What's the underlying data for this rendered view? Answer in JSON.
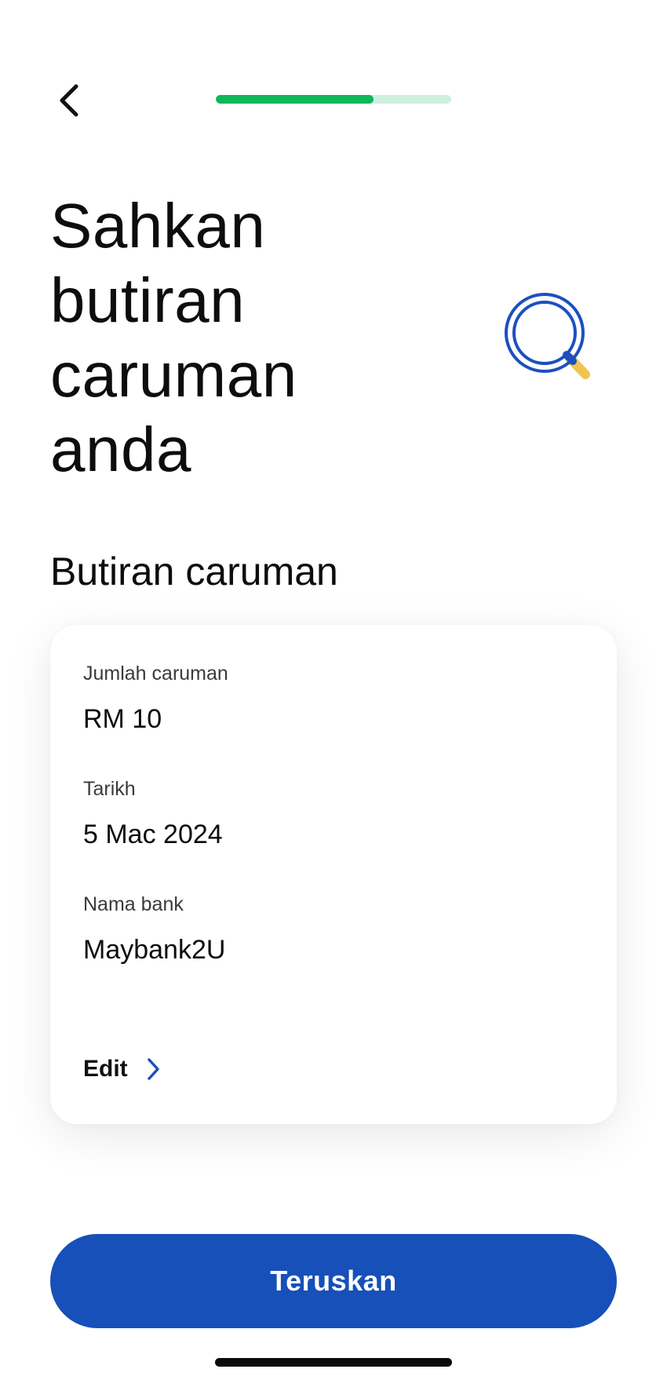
{
  "header": {
    "back_icon": "chevron-left-icon",
    "progress_fraction": 0.67
  },
  "title": {
    "line1": "Sahkan",
    "line2": "butiran",
    "line3": "caruman",
    "line4": "anda",
    "illustration_icon": "magnifying-glass-icon"
  },
  "section": {
    "heading": "Butiran caruman"
  },
  "details": {
    "amount_label": "Jumlah caruman",
    "amount_value": "RM 10",
    "date_label": "Tarikh",
    "date_value": "5 Mac 2024",
    "bank_label": "Nama bank",
    "bank_value": "Maybank2U",
    "edit_label": "Edit",
    "edit_icon": "chevron-right-icon"
  },
  "footer": {
    "continue_label": "Teruskan"
  },
  "colors": {
    "primary": "#1650b8",
    "progress_fill": "#10b75a",
    "progress_track": "#cdf1df",
    "accent_blue": "#1c4fc0",
    "accent_gold": "#f0c350"
  }
}
